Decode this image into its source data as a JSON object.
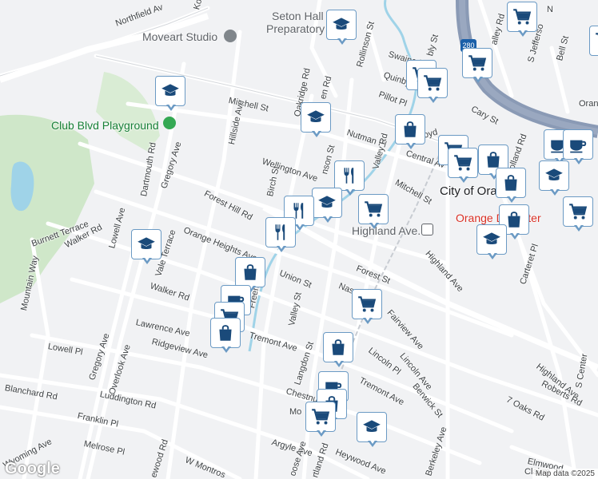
{
  "map": {
    "attribution": "Map data ©2025",
    "logo": "Google",
    "city_label": "City of Ora",
    "colors": {
      "background": "#f1f2f4",
      "road": "#ffffff",
      "road_outline": "#d5d8dc",
      "highway": "#8a9ab5",
      "park": "#cfe7c9",
      "water": "#9fd3e8",
      "pin_fill": "#1a4a7a",
      "pin_border": "#6b9ac4"
    },
    "pois": {
      "seton": "Seton Hall",
      "preparatory": "Preparatory Scho",
      "moveart": "Moveart Studio",
      "club_blvd": "Club Blvd Playground",
      "highland_ave_station": "Highland Ave.",
      "orange_center": "Orange D     Center"
    },
    "shield": "280",
    "streets": {
      "northfield": "Northfield Av",
      "koew": "Koew",
      "mitchell_west": "Mitchell St",
      "oakridge": "Oakridge Rd",
      "hillside": "Hillside Ave",
      "wellington": "Wellington Ave",
      "birch": "Birch St",
      "gregory_north": "Gregory Ave",
      "dartmouth": "Dartmouth Rd",
      "forest_hill": "Forest Hill Rd",
      "orange_heights": "Orange Heights Ave",
      "burnett": "Burnett Terrace",
      "walker_rd": "Walker Rd",
      "lowell_ave": "Lowell Ave",
      "vale": "Vale Terrace",
      "mountain_way": "Mountain Way",
      "walker_rd2": "Walker Rd",
      "union": "Union St",
      "freeman": "Freeman Pl",
      "valley_st": "Valley St",
      "lawrence": "Lawrence Ave",
      "ridgeview": "Ridgeview Ave",
      "tremont_west": "Tremont Ave",
      "lowell_pl": "Lowell Pl",
      "gregory_south": "Gregory Ave",
      "overlook": "Overlook Ave",
      "blanchard": "Blanchard Rd",
      "luddington": "Luddington Rd",
      "franklin": "Franklin Pl",
      "melrose": "Melrose Pl",
      "wyoming": "Wyoming Ave",
      "lewood": "ewood Rd",
      "montrose": "W Montros",
      "rollinson": "Rollinson St",
      "swaine": "Swaine Pl",
      "quinby": "Quinby Pl",
      "pillot": "Pillot Pl",
      "nutman": "Nutman Pl",
      "central": "Central Av",
      "valley_rd": "Valley Rd",
      "mitchell_east": "Mitchell St",
      "cary": "Cary St",
      "bell": "Bell St",
      "sjefferson": "S Jefferso",
      "valley_top": "alley Rd",
      "orange_top": "Orang",
      "n_lbl": "N",
      "holland": "olland Rd",
      "forest_st": "Forest St",
      "highland_ave": "Highland Ave",
      "nassau": "Nassau",
      "fairview": "Fairview Ave",
      "carteret": "Carteret Pl",
      "lincoln_pl": "Lincoln Pl",
      "lincoln_ave": "Lincoln Ave",
      "berwick": "Berwick St",
      "tremont_east": "Tremont Ave",
      "langdon": "Langdon St",
      "chestnut": "Chestnu",
      "mo": "Mo",
      "heywood": "Heywood Ave",
      "argyle": "Argyle Ave",
      "berkeley": "Berkeley Ave",
      "highland_east": "Highland Ave",
      "roberts": "Roberts Rd",
      "seven_oaks": "7 Oaks Rd",
      "elmwood": "Elmwood",
      "clairm": "Clairm",
      "s_center": "S Center",
      "oose": "oose Ave",
      "ortland": "rtland Rd",
      "en_rd": "en Rd",
      "nson": "nson St",
      "bly": "bly St",
      "boyd": "oyd",
      "li": "Li"
    }
  }
}
